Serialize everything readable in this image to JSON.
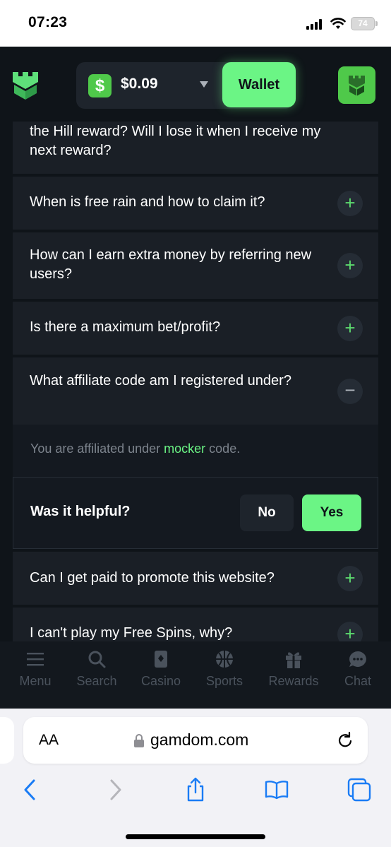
{
  "status_bar": {
    "time": "07:23",
    "battery": "74"
  },
  "header": {
    "balance": "$0.09",
    "currency_symbol": "$",
    "wallet_label": "Wallet"
  },
  "faq": [
    {
      "question": "the Hill reward? Will I lose it when I receive my next reward?",
      "toggle": "+"
    },
    {
      "question": "When is free rain and how to claim it?",
      "toggle": "+"
    },
    {
      "question": "How can I earn extra money by referring new users?",
      "toggle": "+"
    },
    {
      "question": "Is there a maximum bet/profit?",
      "toggle": "+"
    },
    {
      "question": "What affiliate code am I registered under?",
      "toggle": "−"
    },
    {
      "question": "Can I get paid to promote this website?",
      "toggle": "+"
    },
    {
      "question": "I can't play my Free Spins, why?",
      "toggle": "+"
    }
  ],
  "answer": {
    "prefix": "You are affiliated under ",
    "code": "mocker",
    "suffix": " code.",
    "helpful_label": "Was it helpful?",
    "no_label": "No",
    "yes_label": "Yes"
  },
  "bottom_nav": [
    {
      "label": "Menu",
      "icon": "menu-icon"
    },
    {
      "label": "Search",
      "icon": "search-icon"
    },
    {
      "label": "Casino",
      "icon": "casino-icon"
    },
    {
      "label": "Sports",
      "icon": "sports-icon"
    },
    {
      "label": "Rewards",
      "icon": "gift-icon"
    },
    {
      "label": "Chat",
      "icon": "chat-icon"
    }
  ],
  "browser": {
    "aa": "AA",
    "url": "gamdom.com"
  },
  "colors": {
    "accent": "#6bf585",
    "bg": "#0f1419",
    "card": "#1a1f26"
  }
}
